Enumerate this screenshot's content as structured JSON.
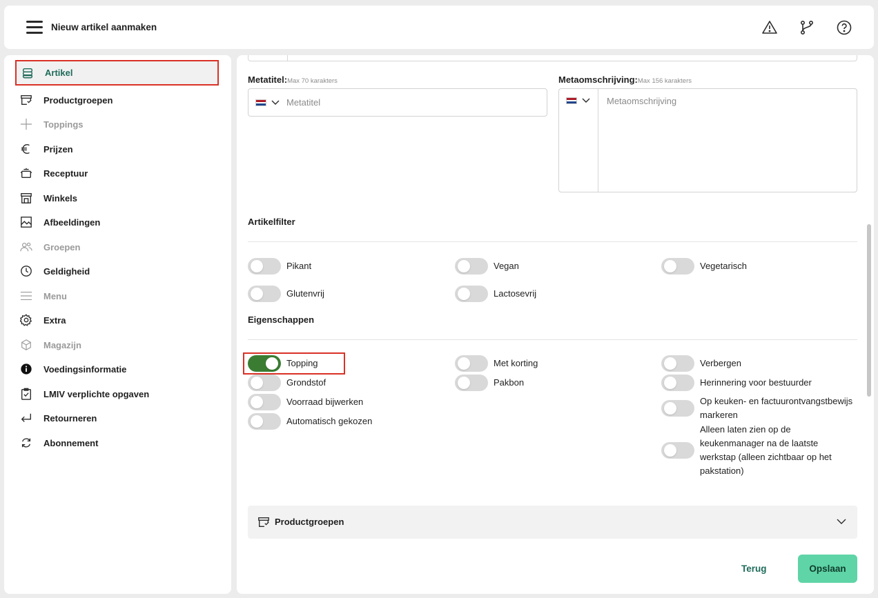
{
  "header": {
    "title": "Nieuw artikel aanmaken",
    "icons": [
      "menu-icon",
      "warning-icon",
      "branch-icon",
      "help-icon"
    ]
  },
  "sidebar": {
    "items": [
      {
        "label": "Artikel",
        "icon": "stack-icon",
        "state": "active"
      },
      {
        "label": "Productgroepen",
        "icon": "tag-box-icon",
        "state": "normal"
      },
      {
        "label": "Toppings",
        "icon": "plus-icon",
        "state": "disabled"
      },
      {
        "label": "Prijzen",
        "icon": "euro-icon",
        "state": "normal"
      },
      {
        "label": "Receptuur",
        "icon": "pot-icon",
        "state": "normal"
      },
      {
        "label": "Winkels",
        "icon": "store-icon",
        "state": "normal"
      },
      {
        "label": "Afbeeldingen",
        "icon": "image-icon",
        "state": "normal"
      },
      {
        "label": "Groepen",
        "icon": "users-icon",
        "state": "disabled"
      },
      {
        "label": "Geldigheid",
        "icon": "clock-icon",
        "state": "normal"
      },
      {
        "label": "Menu",
        "icon": "menu-lines-icon",
        "state": "disabled"
      },
      {
        "label": "Extra",
        "icon": "gear-icon",
        "state": "normal"
      },
      {
        "label": "Magazijn",
        "icon": "cube-icon",
        "state": "disabled"
      },
      {
        "label": "Voedingsinformatie",
        "icon": "info-icon",
        "state": "normal"
      },
      {
        "label": "LMIV verplichte opgaven",
        "icon": "clipboard-check-icon",
        "state": "normal"
      },
      {
        "label": "Retourneren",
        "icon": "return-arrow-icon",
        "state": "normal"
      },
      {
        "label": "Abonnement",
        "icon": "refresh-icon",
        "state": "normal"
      }
    ]
  },
  "form": {
    "metatitle": {
      "label": "Metatitel:",
      "hint": "Max 70 karakters",
      "placeholder": "Metatitel"
    },
    "metadesc": {
      "label": "Metaomschrijving:",
      "hint": "Max 156 karakters",
      "placeholder": "Metaomschrijving"
    },
    "flag_colors": [
      "#ae1c28",
      "#ffffff",
      "#21468b"
    ]
  },
  "artikelfilter": {
    "title": "Artikelfilter",
    "toggles": [
      {
        "label": "Pikant",
        "on": false
      },
      {
        "label": "Vegan",
        "on": false
      },
      {
        "label": "Vegetarisch",
        "on": false
      },
      {
        "label": "Glutenvrij",
        "on": false
      },
      {
        "label": "Lactosevrij",
        "on": false
      }
    ]
  },
  "eigenschappen": {
    "title": "Eigenschappen",
    "toggles": [
      {
        "label": "Topping",
        "on": true
      },
      {
        "label": "Met korting",
        "on": false
      },
      {
        "label": "Verbergen",
        "on": false
      },
      {
        "label": "Grondstof",
        "on": false
      },
      {
        "label": "Pakbon",
        "on": false
      },
      {
        "label": "Herinnering voor bestuurder",
        "on": false
      },
      {
        "label": "Voorraad bijwerken",
        "on": false
      },
      {
        "label": "Op keuken- en factuurontvangstbewijs markeren",
        "on": false
      },
      {
        "label": "Automatisch gekozen",
        "on": false
      },
      {
        "label": "Alleen laten zien op de keukenmanager na de laatste werkstap (alleen zichtbaar op het pakstation)",
        "on": false
      }
    ]
  },
  "accordion": {
    "label": "Productgroepen"
  },
  "footer": {
    "back_label": "Terug",
    "save_label": "Opslaan"
  },
  "colors": {
    "accent_green": "#3a7d32",
    "save_button": "#5fd4a6",
    "active_text": "#1f6b5a",
    "highlight_red": "#d93025"
  }
}
